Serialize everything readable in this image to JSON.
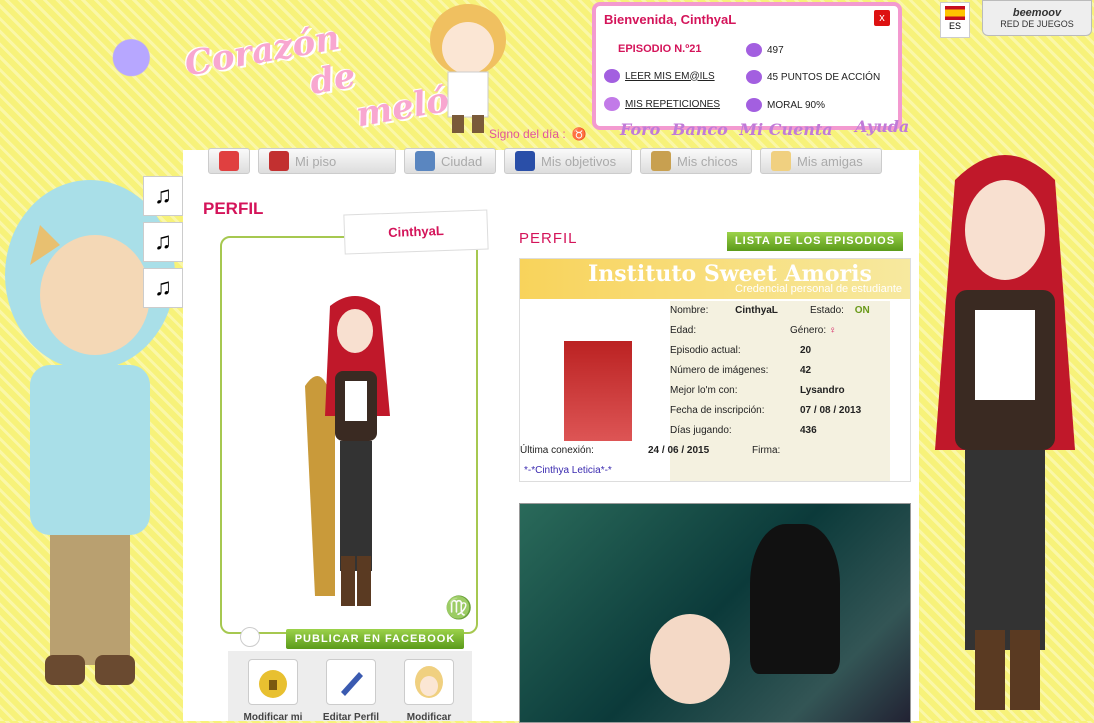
{
  "logo": {
    "line1": "Corazón",
    "line2": "de",
    "line3": "melón"
  },
  "sign_label": "Signo del día :",
  "sign_symbol": "♉",
  "account": {
    "welcome": "Bienvenida, CinthyaL",
    "close": "x",
    "episode": "EPISODIO N.º21",
    "read_mails": "LEER MIS EM@ILS",
    "repetitions": "MIS REPETICIONES",
    "fleur_count": "497",
    "action_points": "45 PUNTOS DE ACCIÓN",
    "moral": "MORAL 90%"
  },
  "top_nav": {
    "foro": "Foro",
    "banco": "Banco",
    "cuenta": "Mi Cuenta",
    "ayuda": "Ayuda"
  },
  "lang": "ES",
  "beemoov": {
    "brand": "beemoov",
    "label": "RED DE JUEGOS"
  },
  "menu": [
    {
      "label": "",
      "color": "#e04040"
    },
    {
      "label": "Mi piso",
      "color": "#c23030"
    },
    {
      "label": "Ciudad",
      "color": "#5a86c0"
    },
    {
      "label": "Mis objetivos",
      "color": "#2a4fa8"
    },
    {
      "label": "Mis chicos",
      "color": "#c8a050"
    },
    {
      "label": "Mis amigas",
      "color": "#f0d080"
    }
  ],
  "music_icon": "♫",
  "page_title": "PERFIL",
  "name_tab": "CinthyaL",
  "zodiac": "♍",
  "fb_button": "PUBLICAR EN FACEBOOK",
  "actions": [
    {
      "label": "Modificar mi",
      "icon": "lock-icon"
    },
    {
      "label": "Editar Perfil",
      "icon": "pen-icon"
    },
    {
      "label": "Modificar",
      "icon": "avatar-icon"
    }
  ],
  "profile_heading": "PERFIL",
  "episodes_button": "LISTA DE LOS EPISODIOS",
  "card": {
    "header": "Instituto Sweet Amoris",
    "sub": "Credencial personal de estudiante",
    "fields": [
      {
        "k": "Nombre:",
        "v": "CinthyaL"
      },
      {
        "k": "Estado:",
        "v": "ON"
      },
      {
        "k": "Edad:",
        "v": ""
      },
      {
        "k": "Género:",
        "v": "♀"
      },
      {
        "k": "Episodio actual:",
        "v": "20"
      },
      {
        "k": "Número de imágenes:",
        "v": "42"
      },
      {
        "k": "Mejor lo'm con:",
        "v": "Lysandro"
      },
      {
        "k": "Fecha de inscripción:",
        "v": "07 / 08 / 2013"
      },
      {
        "k": "Días jugando:",
        "v": "436"
      },
      {
        "k": "Última conexión:",
        "v": "24 / 06 / 2015"
      },
      {
        "k": "Firma:",
        "v": ""
      }
    ],
    "signature": "*-*Cinthya Leticia*-*"
  }
}
